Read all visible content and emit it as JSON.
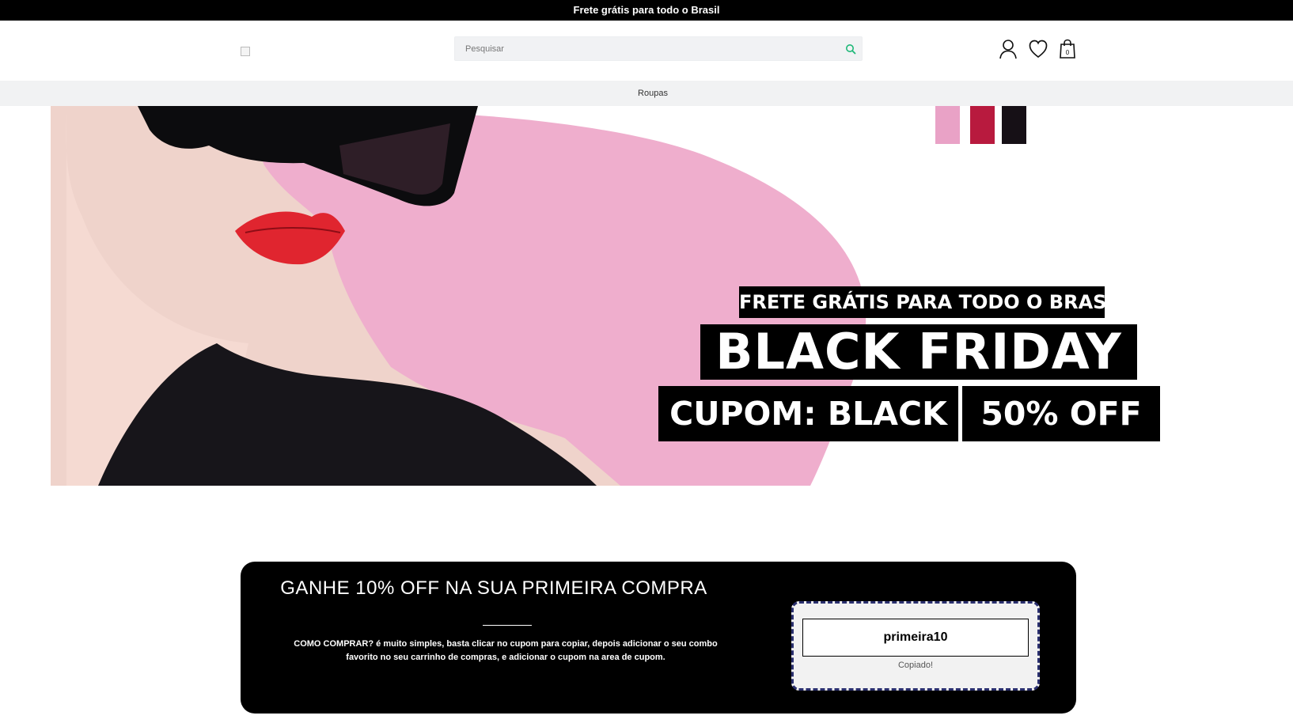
{
  "announcement": {
    "text": "Frete grátis para todo o Brasil"
  },
  "header": {
    "search": {
      "placeholder": "Pesquisar",
      "value": ""
    },
    "cart_count": "0",
    "icons": {
      "search": "search-icon",
      "account": "user-icon",
      "wishlist": "heart-icon",
      "cart": "shopping-bag-icon"
    }
  },
  "nav": {
    "items": [
      {
        "label": "Roupas"
      }
    ]
  },
  "banner": {
    "frete_text": "FRETE GRÁTIS PARA TODO O BRASIL",
    "headline": "BLACK FRIDAY",
    "coupon_text": "CUPOM: BLACK",
    "discount_text": "50% OFF",
    "swatch_colors": [
      "#e9a2c6",
      "#b81a3e",
      "#161016"
    ],
    "background_color": "#efaecd"
  },
  "coupon": {
    "title": "GANHE 10% OFF NA SUA PRIMEIRA COMPRA",
    "description": "COMO COMPRAR? é muito simples, basta clicar no cupom para copiar, depois adicionar o seu combo favorito no seu carrinho de compras, e adicionar o cupom na area de cupom.",
    "code": "primeira10",
    "status": "Copiado!"
  }
}
